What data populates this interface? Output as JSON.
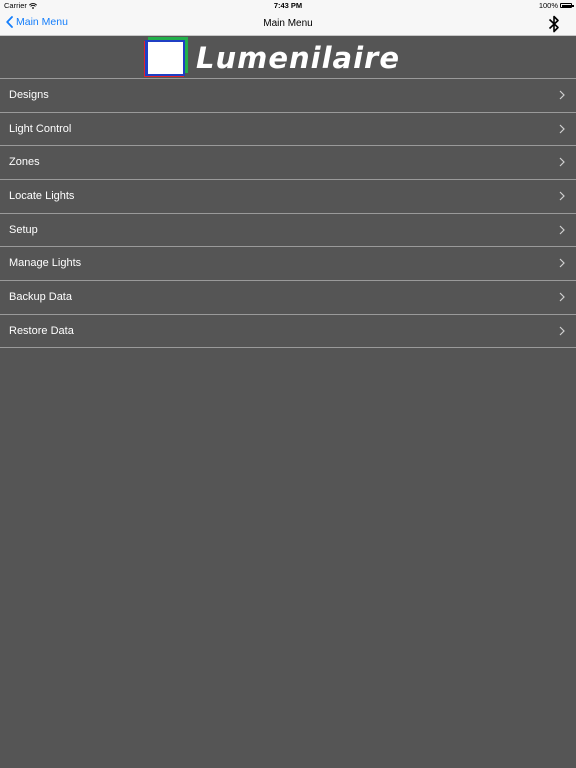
{
  "status_bar": {
    "carrier": "Carrier",
    "time": "7:43 PM",
    "battery": "100%"
  },
  "nav_bar": {
    "back_label": "Main Menu",
    "title": "Main Menu"
  },
  "logo": {
    "text": "Lumenilaire"
  },
  "menu": {
    "items": [
      {
        "label": "Designs"
      },
      {
        "label": "Light Control"
      },
      {
        "label": "Zones"
      },
      {
        "label": "Locate Lights"
      },
      {
        "label": "Setup"
      },
      {
        "label": "Manage Lights"
      },
      {
        "label": "Backup Data"
      },
      {
        "label": "Restore Data"
      }
    ]
  },
  "colors": {
    "background": "#555555",
    "accent": "#147efb",
    "logo_red": "#e0232a",
    "logo_green": "#22b04b",
    "logo_blue": "#1f3fc4"
  }
}
